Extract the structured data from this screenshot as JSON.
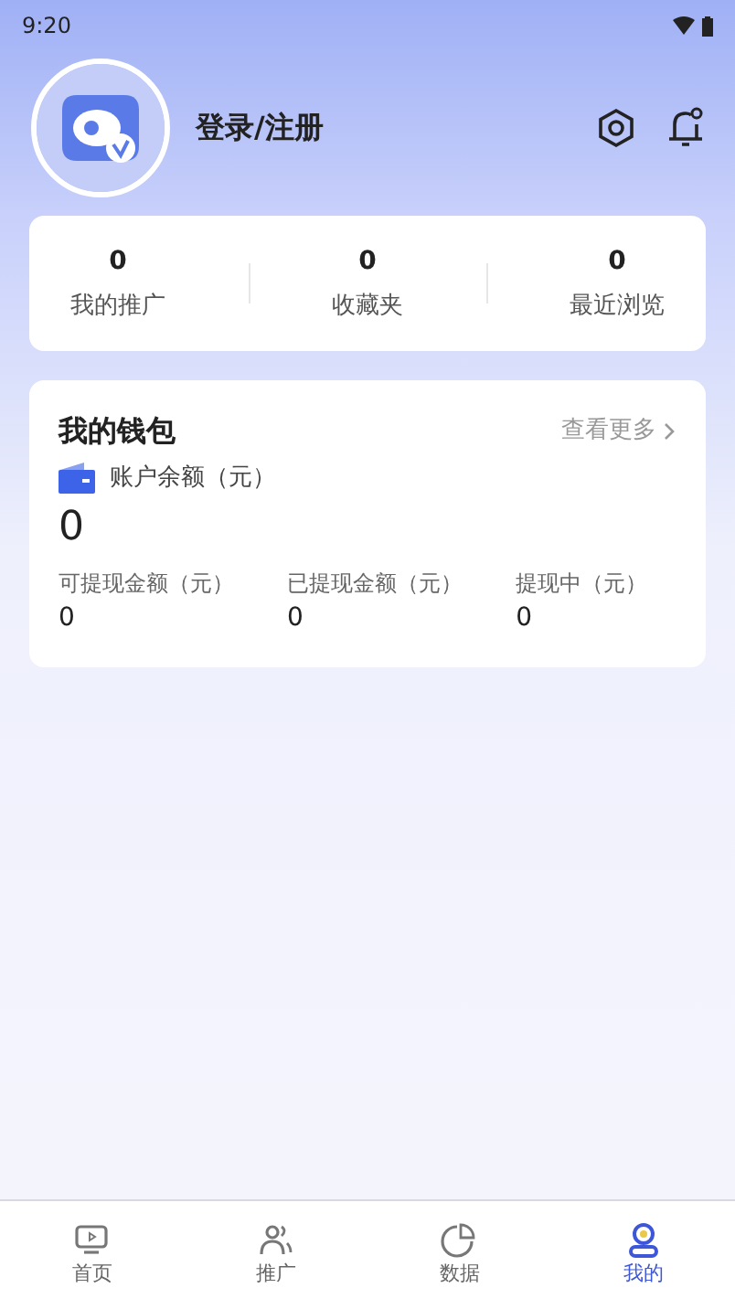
{
  "status_bar": {
    "time": "9:20"
  },
  "profile": {
    "login_label": "登录/注册"
  },
  "stats": [
    {
      "value": "0",
      "label": "我的推广"
    },
    {
      "value": "0",
      "label": "收藏夹"
    },
    {
      "value": "0",
      "label": "最近浏览"
    }
  ],
  "wallet": {
    "title": "我的钱包",
    "more_link": "查看更多",
    "balance_label": "账户余额（元）",
    "balance": "0",
    "items": [
      {
        "label": "可提现金额（元）",
        "value": "0"
      },
      {
        "label": "已提现金额（元）",
        "value": "0"
      },
      {
        "label": "提现中（元）",
        "value": "0"
      }
    ]
  },
  "tab_bar": [
    {
      "label": "首页",
      "kind": "home",
      "selected": false
    },
    {
      "label": "推广",
      "kind": "promote",
      "selected": false
    },
    {
      "label": "数据",
      "kind": "data",
      "selected": false
    },
    {
      "label": "我的",
      "kind": "me",
      "selected": true
    }
  ]
}
